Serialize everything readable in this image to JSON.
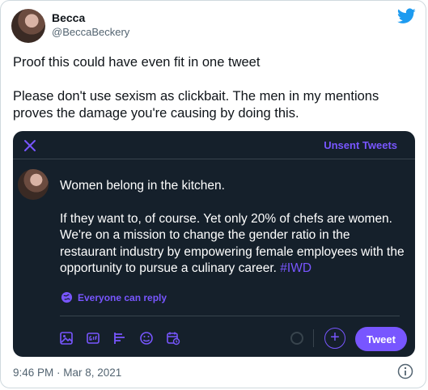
{
  "author": {
    "name": "Becca",
    "handle": "@BeccaBeckery"
  },
  "tweet": {
    "line1": "Proof this could have even fit in one tweet",
    "line2": "Please don't use sexism as clickbait. The men in my mentions proves the damage you're causing by doing this.",
    "timestamp": "9:46 PM · Mar 8, 2021"
  },
  "embed": {
    "header_label": "Unsent Tweets",
    "para1": "Women belong in the kitchen.",
    "para2": "If they want to, of course. Yet only 20% of chefs are women. We're on a mission to change the gender ratio in the restaurant industry by empowering female employees with the opportunity to pursue a culinary career.",
    "hashtag": "#IWD",
    "reply_setting": "Everyone can reply",
    "tweet_button": "Tweet",
    "plus_symbol": "+"
  },
  "colors": {
    "accent": "#7856ff",
    "embed_bg": "#15202b",
    "twitter_blue": "#1d9bf0"
  },
  "icons": [
    "twitter-bird-icon",
    "close-icon",
    "globe-icon",
    "image-icon",
    "gif-icon",
    "poll-icon",
    "emoji-icon",
    "schedule-icon",
    "plus-icon",
    "info-icon"
  ]
}
